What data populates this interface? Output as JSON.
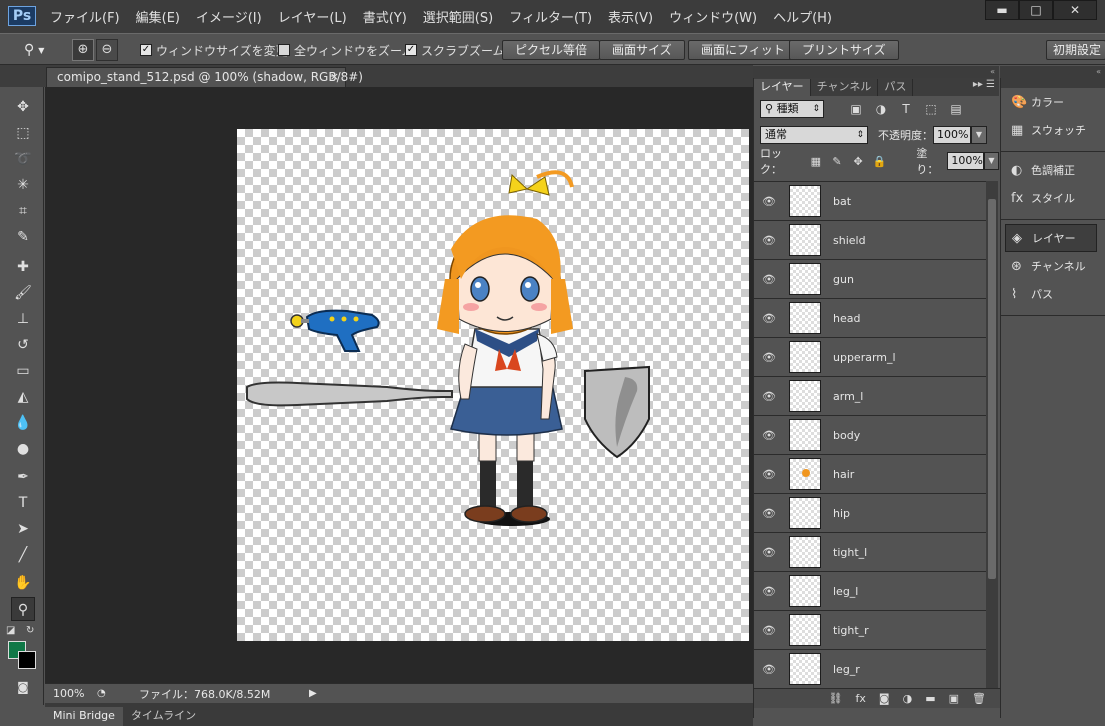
{
  "app": {
    "logo": "Ps"
  },
  "menu": [
    "ファイル(F)",
    "編集(E)",
    "イメージ(I)",
    "レイヤー(L)",
    "書式(Y)",
    "選択範囲(S)",
    "フィルター(T)",
    "表示(V)",
    "ウィンドウ(W)",
    "ヘルプ(H)"
  ],
  "window_buttons": {
    "minimize": "▬",
    "maximize": "□",
    "close": "✕"
  },
  "options": {
    "resize_windows": "ウィンドウサイズを変更",
    "zoom_all": "全ウィンドウをズーム",
    "scrubby_zoom": "スクラブズーム",
    "actual_pixels": "ピクセル等倍",
    "fit_screen": "画面サイズ",
    "fill_screen": "画面にフィット",
    "print_size": "プリントサイズ",
    "workspace": "初期設定"
  },
  "document": {
    "tab_title": "comipo_stand_512.psd @ 100% (shadow, RGB/8#)",
    "close": "×"
  },
  "status": {
    "zoom": "100%",
    "file_info": "ファイル：768.0K/8.52M"
  },
  "bottom_tabs": [
    "Mini Bridge",
    "タイムライン"
  ],
  "panel_tabs": [
    "レイヤー",
    "チャンネル",
    "パス"
  ],
  "layers_panel": {
    "filter_kind": "種類",
    "blend_mode": "通常",
    "opacity_label": "不透明度：",
    "opacity": "100%",
    "lock_label": "ロック：",
    "fill_label": "塗り：",
    "fill": "100%",
    "layers": [
      "bat",
      "shield",
      "gun",
      "head",
      "upperarm_l",
      "arm_l",
      "body",
      "hair",
      "hip",
      "tight_l",
      "leg_l",
      "tight_r",
      "leg_r"
    ]
  },
  "dock": {
    "items": [
      "カラー",
      "スウォッチ",
      "色調補正",
      "スタイル",
      "レイヤー",
      "チャンネル",
      "パス"
    ]
  },
  "colors": {
    "foreground": "#107847",
    "background": "#000000"
  }
}
